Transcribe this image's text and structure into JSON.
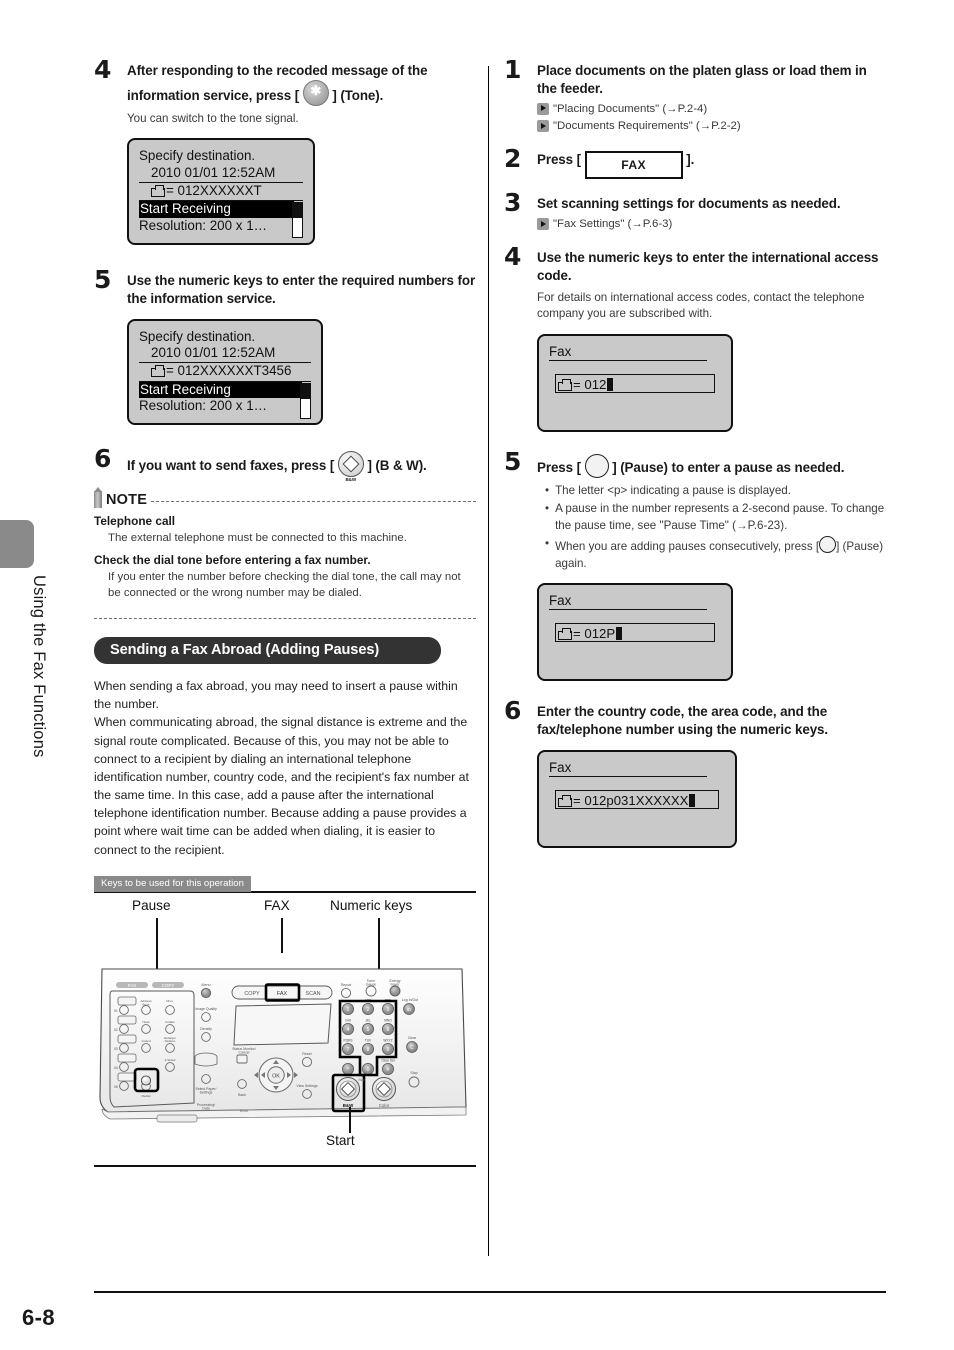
{
  "sidebar": {
    "chapter_label": "Using the Fax Functions"
  },
  "footer": {
    "page_number": "6-8"
  },
  "left_column": {
    "steps": [
      {
        "num": "4",
        "title_pre": "After responding to the recoded message of the information service, press [",
        "title_post": "] (Tone).",
        "body": "You can switch to the tone signal.",
        "lcd": {
          "line1": "Specify destination.",
          "line2": "2010 01/01 12:52AM",
          "line3": "= 012XXXXXXT",
          "line4": "Start Receiving",
          "line5": "Resolution: 200 x 1…"
        }
      },
      {
        "num": "5",
        "title": "Use the numeric keys to enter the required numbers for the information service.",
        "lcd": {
          "line1": "Specify destination.",
          "line2": "2010 01/01 12:52AM",
          "line3": "= 012XXXXXXT3456",
          "line4": "Start Receiving",
          "line5": "Resolution: 200 x 1…"
        }
      },
      {
        "num": "6",
        "title_pre": "If you want to send faxes, press [",
        "title_post": "] (B & W)."
      }
    ],
    "note": {
      "heading": "NOTE",
      "items": [
        {
          "bold": "Telephone call",
          "text": "The external telephone must be connected to this machine."
        },
        {
          "bold": "Check the dial tone before entering a fax number.",
          "text": "If you enter the number before checking the dial tone, the call may not be connected or the wrong number may be dialed."
        }
      ]
    },
    "section": {
      "title": "Sending a Fax Abroad (Adding Pauses)",
      "intro_paragraphs": [
        "When sending a fax abroad, you may need to insert a pause within the number.",
        "When communicating abroad, the signal distance is extreme and the signal route complicated. Because of this, you may not be able to connect to a recipient by dialing an international telephone identification number, country code, and the recipient's fax number at the same time. In this case, add a pause after the international telephone identification number. Because adding a pause provides a point where wait time can be added when dialing, it is easier to connect to the recipient."
      ]
    },
    "keys_figure": {
      "tab_label": "Keys to be used for this operation",
      "callouts": {
        "pause": "Pause",
        "fax": "FAX",
        "numeric_keys": "Numeric keys",
        "start": "Start"
      },
      "panel_labels": {
        "menu": "Menu",
        "copy": "COPY",
        "fax": "FAX",
        "scan": "SCAN",
        "image_quality": "Image Quality",
        "density": "Density",
        "status_monitor_cancel": "Status Monitor/\nCancel",
        "select_paper_settings": "Select Paper/\nSettings",
        "processing_data": "Processing/\nData",
        "error": "Error",
        "back": "Back",
        "ok": "OK",
        "reset": "Reset",
        "view_settings": "View Settings",
        "report": "Report",
        "toner_gauge": "Toner\nGauge",
        "energy_saver": "Energy\nSaver",
        "log_in_out": "Log In/Out",
        "id": "ID",
        "clear": "Clear",
        "c": "C",
        "stop": "Stop",
        "bw": "B&W",
        "color": "Color",
        "tone": "Tone",
        "pause": "Pause",
        "redial": "Redial",
        "hook": "Hook",
        "coded_dial": "Coded Dial",
        "address_book": "Address\nBook",
        "paper_select": "Paper\nSelect",
        "enlarge_reduce": "Enlarge/\nReduce",
        "collate": "Collate",
        "2sided": "2-Sided",
        "sided": "Sided",
        "fax_tab": "FAX",
        "copy_tab": "COPY",
        "one_touch": [
          "01",
          "02",
          "03",
          "04",
          "05"
        ],
        "keypad": [
          {
            "digit": "1",
            "letters": ""
          },
          {
            "digit": "2",
            "letters": "ABC"
          },
          {
            "digit": "3",
            "letters": "DEF"
          },
          {
            "digit": "4",
            "letters": "GHI"
          },
          {
            "digit": "5",
            "letters": "JKL"
          },
          {
            "digit": "6",
            "letters": "MNO"
          },
          {
            "digit": "7",
            "letters": "PQRS"
          },
          {
            "digit": "8",
            "letters": "TUV"
          },
          {
            "digit": "9",
            "letters": "WXYZ"
          },
          {
            "digit": "*",
            "letters": ""
          },
          {
            "digit": "0",
            "letters": ""
          },
          {
            "digit": "#",
            "letters": ""
          }
        ]
      }
    }
  },
  "right_column": {
    "steps": [
      {
        "num": "1",
        "title": "Place documents on the platen glass or load them in the feeder.",
        "refs": [
          "\"Placing Documents\" (→P.2-4)",
          "\"Documents Requirements\" (→P.2-2)"
        ]
      },
      {
        "num": "2",
        "title_pre": "Press [",
        "button_label": "FAX",
        "title_post": "]."
      },
      {
        "num": "3",
        "title": "Set scanning settings for documents as needed.",
        "refs": [
          "\"Fax Settings\" (→P.6-3)"
        ]
      },
      {
        "num": "4",
        "title": "Use the numeric keys to enter the international access code.",
        "body": "For details on international access codes, contact the telephone company you are subscribed with.",
        "lcd": {
          "title": "Fax",
          "field": "= 012"
        }
      },
      {
        "num": "5",
        "title_pre": "Press [",
        "title_post": "] (Pause) to enter a pause as needed.",
        "bullets": [
          "The letter <p> indicating a pause is displayed.",
          "A pause in the number represents a 2-second pause. To change the pause time, see \"Pause Time\" (→P.6-23).",
          "When you are adding pauses consecutively, press [ ] (Pause) again."
        ],
        "bullet3_pre": "When you are adding pauses consecutively, press [",
        "bullet3_post": "] (Pause) again.",
        "lcd": {
          "title": "Fax",
          "field": "= 012P"
        }
      },
      {
        "num": "6",
        "title": "Enter the country code, the area code, and the fax/telephone number using the numeric keys.",
        "lcd": {
          "title": "Fax",
          "field": "= 012p031XXXXXX"
        }
      }
    ]
  },
  "colors": {
    "pill_bg": "#333333",
    "tab_gray": "#8a8a8a",
    "lcd_bg": "#c9c9c9",
    "ink": "#1a1a1a"
  }
}
